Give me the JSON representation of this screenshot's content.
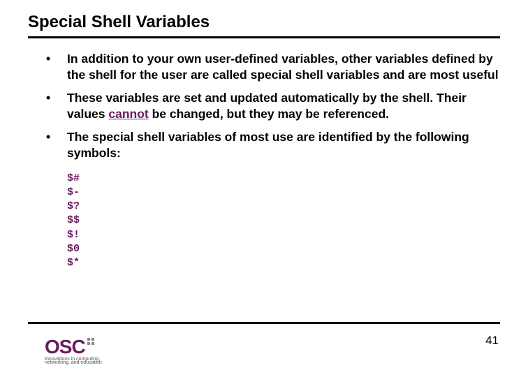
{
  "title": "Special Shell Variables",
  "bullets": [
    {
      "pre": "In addition to your own user-defined variables, other variables defined by the shell for the user are called special shell variables and are most useful",
      "em": "",
      "post": ""
    },
    {
      "pre": "These variables are set and updated automatically by the shell. Their values ",
      "em": "cannot",
      "post": " be changed, but they may be referenced."
    },
    {
      "pre": "The special shell variables of most use are identified by the following symbols:",
      "em": "",
      "post": ""
    }
  ],
  "symbols": [
    "$#",
    "$-",
    "$?",
    "$$",
    "$!",
    "$0",
    "$*"
  ],
  "logo": {
    "text": "OSC",
    "tag1": "Innovations in computing,",
    "tag2": "networking, and education"
  },
  "page_number": "41"
}
